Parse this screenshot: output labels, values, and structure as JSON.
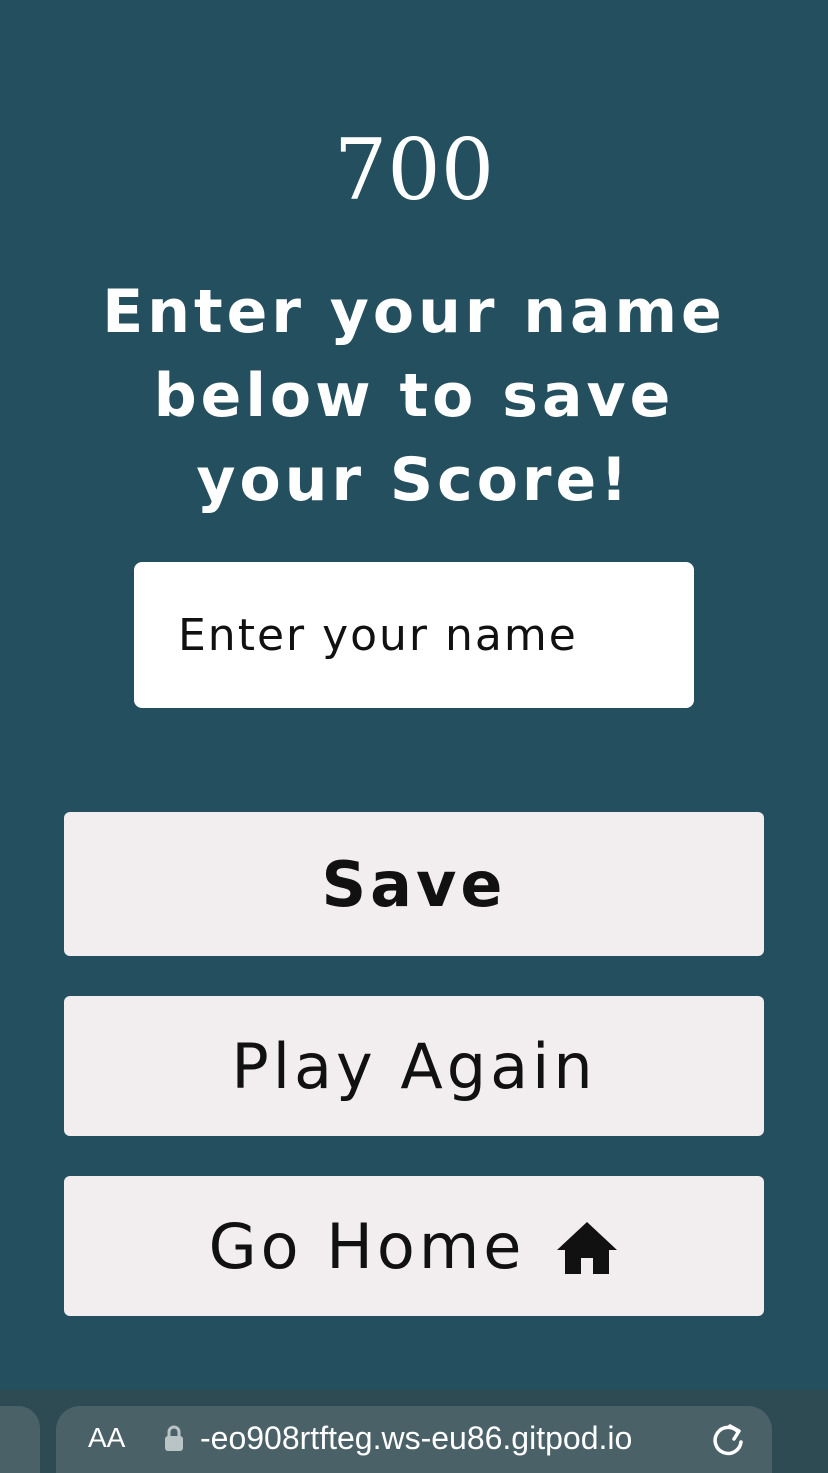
{
  "score": "700",
  "prompt": "Enter your name below to save your Score!",
  "name_input": {
    "value": "",
    "placeholder": "Enter your name"
  },
  "buttons": {
    "save_label": "Save",
    "play_again_label": "Play Again",
    "go_home_label": "Go Home",
    "go_home_icon": "home-icon"
  },
  "browser": {
    "text_size_label": "AA",
    "url": "-eo908rtfteg.ws-eu86.gitpod.io",
    "lock_icon": "lock-icon",
    "reload_icon": "reload-icon"
  },
  "colors": {
    "background": "#234f5e",
    "button_bg": "#f2eeef",
    "text_light": "#ffffff",
    "text_dark": "#111111"
  }
}
